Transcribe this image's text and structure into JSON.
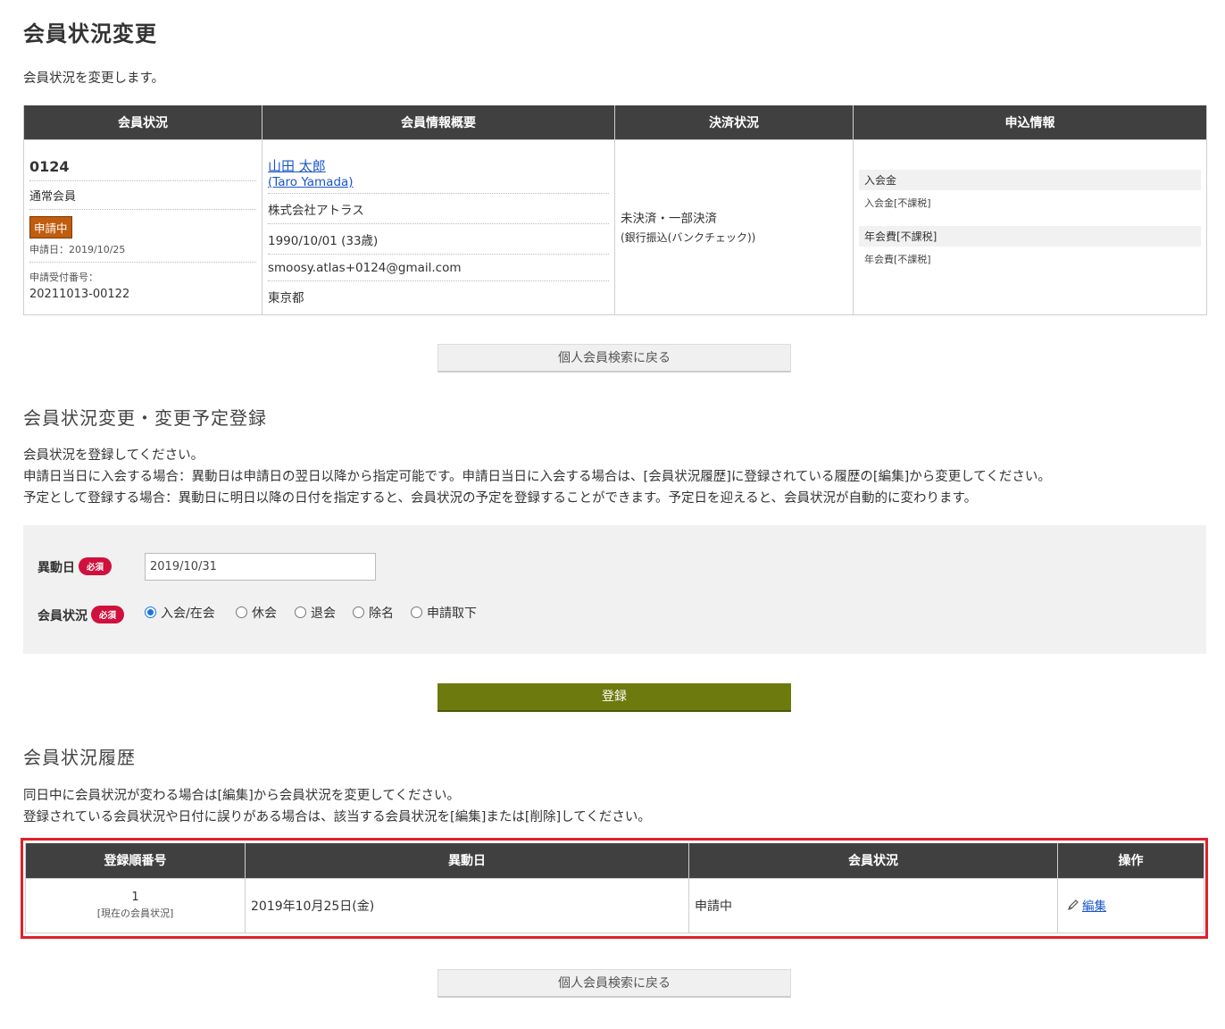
{
  "page_title": "会員状況変更",
  "intro": "会員状況を変更します。",
  "summary_table": {
    "headers": [
      "会員状況",
      "会員情報概要",
      "決済状況",
      "申込情報"
    ],
    "member_number": "0124",
    "member_type": "通常会員",
    "status_badge": "申請中",
    "apply_date": "申請日：2019/10/25",
    "receipt_label": "申請受付番号：",
    "receipt_number": "20211013-00122",
    "name": "山田 太郎",
    "name_en": "(Taro Yamada)",
    "company": "株式会社アトラス",
    "birthdate": "1990/10/01 (33歳)",
    "email": "smoosy.atlas+0124@gmail.com",
    "prefecture": "東京都",
    "payment_status": "未決済・一部決済",
    "payment_method": "(銀行振込(バンクチェック))",
    "app_info": [
      {
        "title": "入会金",
        "sub": "入会金[不課税]"
      },
      {
        "title": "年会費[不課税]",
        "sub": "年会費[不課税]"
      }
    ]
  },
  "back_button_label": "個人会員検索に戻る",
  "register_section": {
    "title": "会員状況変更・変更予定登録",
    "lines": [
      "会員状況を登録してください。",
      "申請日当日に入会する場合：異動日は申請日の翌日以降から指定可能です。申請日当日に入会する場合は、[会員状況履歴]に登録されている履歴の[編集]から変更してください。",
      "予定として登録する場合：異動日に明日以降の日付を指定すると、会員状況の予定を登録することができます。予定日を迎えると、会員状況が自動的に変わります。"
    ],
    "date_label": "異動日",
    "required_label": "必須",
    "date_value": "2019/10/31",
    "status_label": "会員状況",
    "status_options": [
      "入会/在会",
      "休会",
      "退会",
      "除名",
      "申請取下"
    ],
    "selected_option": "入会/在会",
    "submit_label": "登録"
  },
  "history_section": {
    "title": "会員状況履歴",
    "lines": [
      "同日中に会員状況が変わる場合は[編集]から会員状況を変更してください。",
      "登録されている会員状況や日付に誤りがある場合は、該当する会員状況を[編集]または[削除]してください。"
    ],
    "headers": [
      "登録順番号",
      "異動日",
      "会員状況",
      "操作"
    ],
    "rows": [
      {
        "no": "1",
        "current": "[現在の会員状況]",
        "date": "2019年10月25日(金)",
        "status": "申請中",
        "action": "編集"
      }
    ]
  },
  "colors": {
    "header_bg": "#404040",
    "submit_bg": "#6d7a0d",
    "badge_bg": "#c05d0e",
    "required_bg": "#d0103d",
    "highlight_border": "#e0202a",
    "link": "#1a55c9"
  }
}
